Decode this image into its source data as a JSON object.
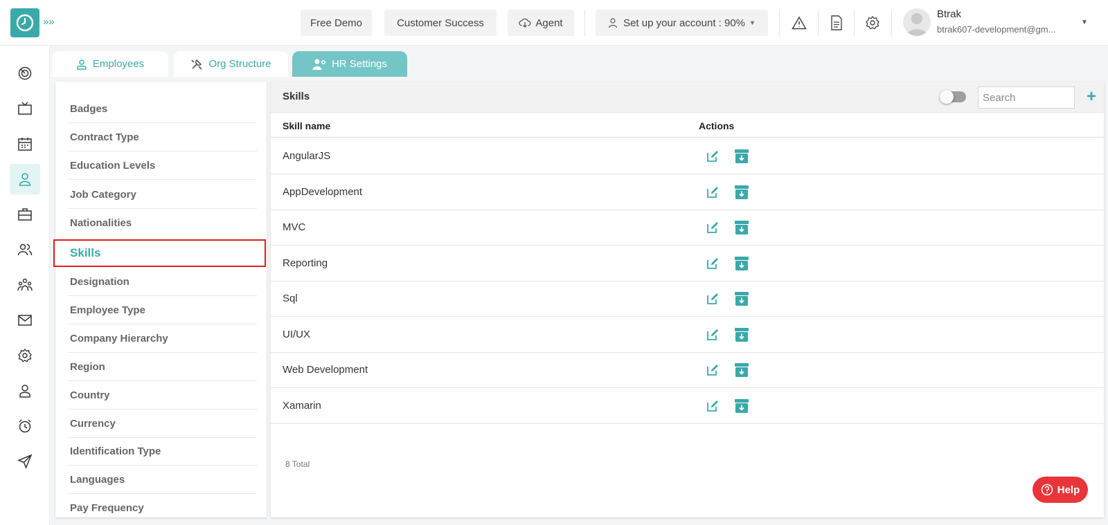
{
  "topbar": {
    "free_demo": "Free Demo",
    "customer_success": "Customer Success",
    "agent": "Agent",
    "setup_account": "Set up your account : 90%",
    "user_name": "Btrak",
    "user_email": "btrak607-development@gm..."
  },
  "tabs": [
    {
      "label": "Employees",
      "icon": "user-icon"
    },
    {
      "label": "Org Structure",
      "icon": "tools-icon"
    },
    {
      "label": "HR Settings",
      "icon": "user-settings-icon",
      "active": true
    }
  ],
  "settings_menu": {
    "selected": "Skills",
    "items": [
      "Badges",
      "Contract Type",
      "Education Levels",
      "Job Category",
      "Nationalities",
      "Skills",
      "Designation",
      "Employee Type",
      "Company Hierarchy",
      "Region",
      "Country",
      "Currency",
      "Identification Type",
      "Languages",
      "Pay Frequency"
    ]
  },
  "panel": {
    "title": "Skills",
    "search_placeholder": "Search",
    "columns": {
      "skill_name": "Skill name",
      "actions": "Actions"
    },
    "rows": [
      "AngularJS",
      "AppDevelopment",
      "MVC",
      "Reporting",
      "Sql",
      "UI/UX",
      "Web Development",
      "Xamarin"
    ],
    "total": "8 Total"
  },
  "help": "Help",
  "colors": {
    "accent": "#3aa9a9",
    "tab_active": "#74c5c5",
    "highlight": "#e21c1c",
    "help": "#e8353a"
  }
}
